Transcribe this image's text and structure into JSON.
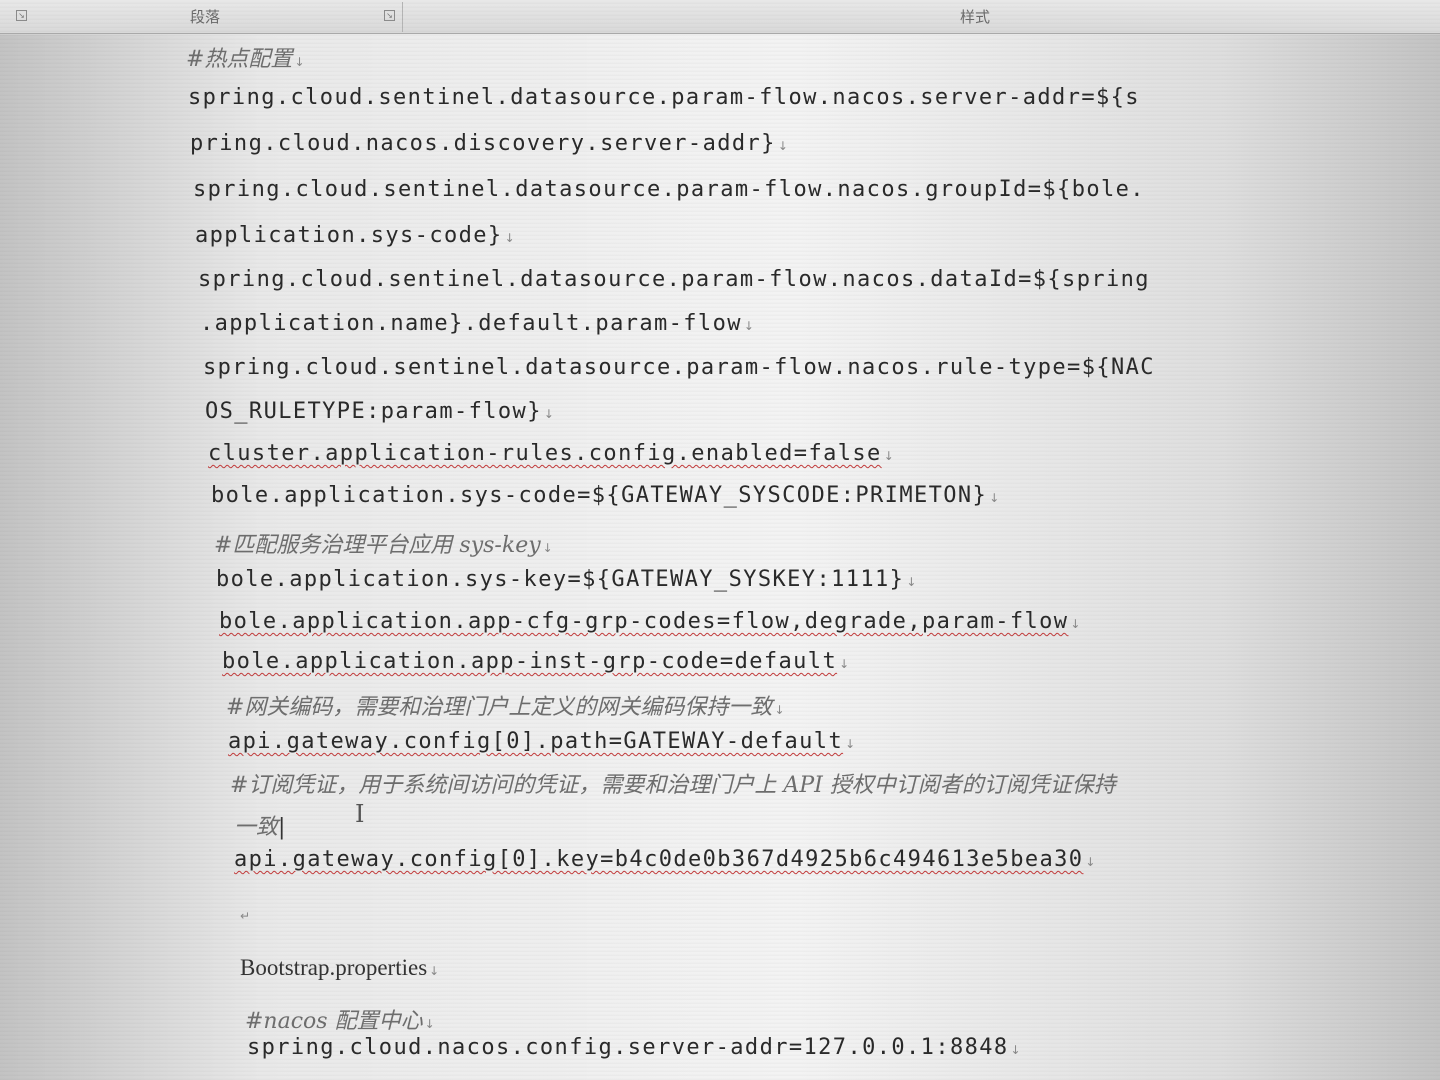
{
  "ribbon": {
    "paragraph_group": "段落",
    "styles_group": "样式"
  },
  "document": {
    "comment_hotspot": "#热点配置",
    "line1": "spring.cloud.sentinel.datasource.param-flow.nacos.server-addr=${s",
    "line2": "pring.cloud.nacos.discovery.server-addr}",
    "line3": "spring.cloud.sentinel.datasource.param-flow.nacos.groupId=${bole.",
    "line4": "application.sys-code}",
    "line5": "spring.cloud.sentinel.datasource.param-flow.nacos.dataId=${spring",
    "line6": ".application.name}.default.param-flow",
    "line7": "spring.cloud.sentinel.datasource.param-flow.nacos.rule-type=${NAC",
    "line8": "OS_RULETYPE:param-flow}",
    "line9": "cluster.application-rules.config.enabled=false",
    "line10": "bole.application.sys-code=${GATEWAY_SYSCODE:PRIMETON}",
    "comment_syskey": "#匹配服务治理平台应用 sys-key",
    "line11": "bole.application.sys-key=${GATEWAY_SYSKEY:1111}",
    "line12": "bole.application.app-cfg-grp-codes=flow,degrade,param-flow",
    "line13": "bole.application.app-inst-grp-code=default",
    "comment_gateway": "#网关编码，需要和治理门户上定义的网关编码保持一致",
    "line14": "api.gateway.config[0].path=GATEWAY-default",
    "comment_credential_1": "#订阅凭证，用于系统间访问的凭证，需要和治理门户上 API 授权中订阅者的订阅凭证保持",
    "comment_credential_2": "一致",
    "line15": "api.gateway.config[0].key=b4c0de0b367d4925b6c494613e5bea30",
    "heading_bootstrap": "Bootstrap.properties",
    "comment_nacos": "#nacos 配置中心",
    "line16": "spring.cloud.nacos.config.server-addr=127.0.0.1:8848"
  },
  "icons": {
    "paragraph_mark": "paragraph-mark-icon",
    "dialog_launcher": "dialog-launcher-icon",
    "text_cursor": "ibeam-cursor-icon"
  },
  "colors": {
    "spellcheck_underline": "#c23a3a",
    "comment_text": "#6e6e6e",
    "code_text": "#2a2a2a"
  }
}
